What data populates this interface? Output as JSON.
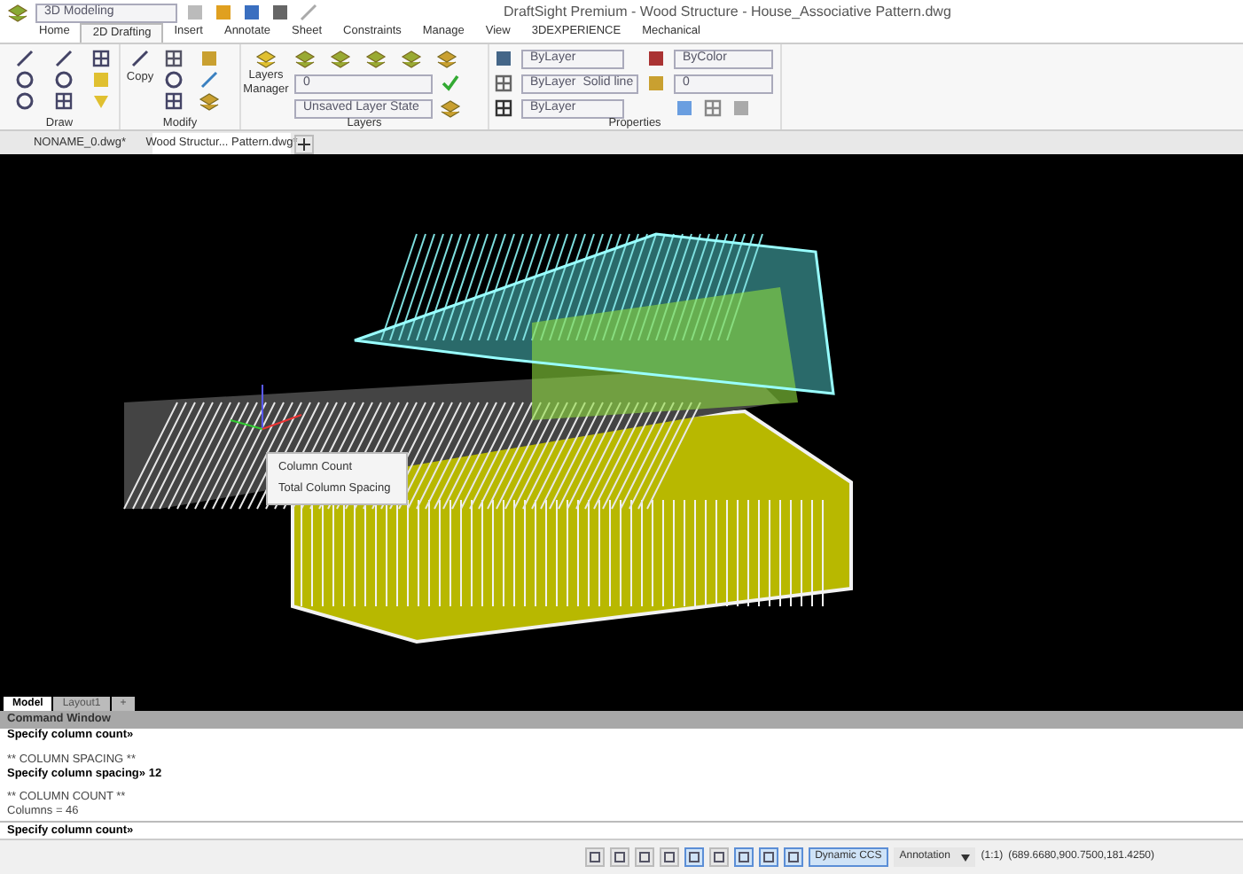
{
  "quick_access": {
    "workspace": "3D Modeling"
  },
  "window": {
    "title": "DraftSight Premium - Wood Structure - House_Associative Pattern.dwg"
  },
  "ribbon_tabs": [
    {
      "label": "Home",
      "selected": false
    },
    {
      "label": "2D Drafting",
      "selected": true
    },
    {
      "label": "Insert",
      "selected": false
    },
    {
      "label": "Annotate",
      "selected": false
    },
    {
      "label": "Sheet",
      "selected": false
    },
    {
      "label": "Constraints",
      "selected": false
    },
    {
      "label": "Manage",
      "selected": false
    },
    {
      "label": "View",
      "selected": false
    },
    {
      "label": "3DEXPERIENCE",
      "selected": false
    },
    {
      "label": "Mechanical",
      "selected": false
    }
  ],
  "ribbon": {
    "draw": {
      "label": "Draw"
    },
    "modify": {
      "label": "Modify",
      "copy_button": "Copy"
    },
    "layers": {
      "label": "Layers",
      "manager_button": "Layers Manager",
      "layer": "0",
      "layer_state": "Unsaved Layer State"
    },
    "properties": {
      "label": "Properties",
      "color_setting": "ByLayer",
      "linetype": "ByLayer",
      "linetype_name": "Solid line",
      "lineweight": "ByLayer",
      "plot_style": "ByColor",
      "transparency": "0"
    }
  },
  "document_tabs": [
    {
      "label": "NONAME_0.dwg*",
      "selected": false
    },
    {
      "label": "Wood Structur... Pattern.dwg*",
      "selected": true
    }
  ],
  "context_menu": [
    "Column Count",
    "Total Column Spacing"
  ],
  "layout_tabs": [
    {
      "label": "Model",
      "selected": true
    },
    {
      "label": "Layout1",
      "selected": false
    },
    {
      "label": "+",
      "selected": false
    }
  ],
  "command_window": {
    "title": "Command Window",
    "lines": [
      {
        "kind": "prompt",
        "text": "Specify column count»"
      },
      {
        "kind": "blank"
      },
      {
        "kind": "info",
        "text": "** COLUMN SPACING **"
      },
      {
        "kind": "prompt",
        "text": "Specify column spacing» 12"
      },
      {
        "kind": "blank"
      },
      {
        "kind": "info",
        "text": "** COLUMN COUNT **"
      },
      {
        "kind": "info",
        "text": "Columns = 46"
      }
    ],
    "input": "Specify column count»"
  },
  "status_bar": {
    "toggles": [
      {
        "on": false
      },
      {
        "on": false
      },
      {
        "on": false
      },
      {
        "on": false
      },
      {
        "on": true
      },
      {
        "on": false
      },
      {
        "on": true
      },
      {
        "on": true
      },
      {
        "on": true
      }
    ],
    "dynamic_ccs": {
      "label": "Dynamic CCS",
      "on": true
    },
    "annotation": "Annotation",
    "scale": "(1:1)",
    "coordinates": "(689.6680,900.7500,181.4250)"
  }
}
